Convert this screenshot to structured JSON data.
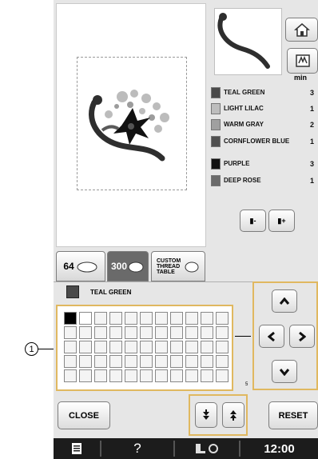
{
  "callout": {
    "number": "1"
  },
  "minutes_header": "min",
  "threads": [
    {
      "name": "TEAL GREEN",
      "minutes": "3",
      "color": "#4a4a4a"
    },
    {
      "name": "LIGHT LILAC",
      "minutes": "1",
      "color": "#bdbdbd"
    },
    {
      "name": "WARM GRAY",
      "minutes": "2",
      "color": "#a0a0a0"
    },
    {
      "name": "CORNFLOWER BLUE",
      "minutes": "1",
      "color": "#505050"
    },
    {
      "name": "PURPLE",
      "minutes": "3",
      "color": "#111111"
    },
    {
      "name": "DEEP ROSE",
      "minutes": "1",
      "color": "#6a6a6a"
    }
  ],
  "tabs": {
    "tab1_number": "64",
    "tab2_number": "300",
    "tab3_label": "CUSTOM THREAD TABLE"
  },
  "selected_thread": "TEAL GREEN",
  "grid_side_label": "5",
  "buttons": {
    "close": "CLOSE",
    "reset": "RESET"
  },
  "status": {
    "time": "12:00",
    "help": "?"
  },
  "icons": {
    "home": "home-icon",
    "frame": "embroidery-frame-icon",
    "spool_minus": "spool-minus-icon",
    "spool_plus": "spool-plus-icon",
    "up": "arrow-up-icon",
    "down": "arrow-down-icon",
    "left": "arrow-left-icon",
    "right": "arrow-right-icon",
    "order_down": "move-down-icon",
    "order_up": "move-up-icon",
    "document": "document-icon",
    "presser": "presser-foot-icon"
  }
}
